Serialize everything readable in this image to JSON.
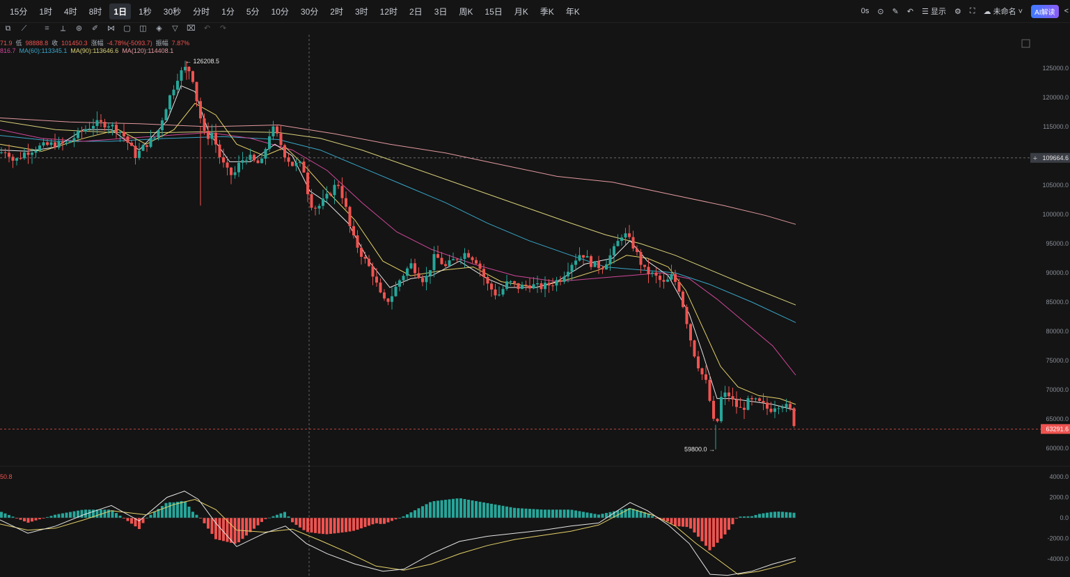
{
  "timeframes": [
    {
      "label": "15分"
    },
    {
      "label": "1时"
    },
    {
      "label": "4时"
    },
    {
      "label": "8时"
    },
    {
      "label": "1日",
      "active": true
    },
    {
      "label": "1秒"
    },
    {
      "label": "30秒"
    },
    {
      "label": "分时"
    },
    {
      "label": "1分"
    },
    {
      "label": "5分"
    },
    {
      "label": "10分"
    },
    {
      "label": "30分"
    },
    {
      "label": "2时"
    },
    {
      "label": "3时"
    },
    {
      "label": "12时"
    },
    {
      "label": "2日"
    },
    {
      "label": "3日"
    },
    {
      "label": "周K"
    },
    {
      "label": "15日"
    },
    {
      "label": "月K"
    },
    {
      "label": "季K"
    },
    {
      "label": "年K"
    }
  ],
  "top_right": {
    "countdown": "0s",
    "display_label": "显示",
    "layout_name": "未命名",
    "ai_label": "AI解读"
  },
  "legend": {
    "ohlc": {
      "open_frag": "71.9",
      "low_label": "低",
      "low": "98888.8",
      "close_label": "收",
      "close": "101450.3",
      "change_label": "涨幅",
      "change": "-4.78%(-5093.7)",
      "amp_label": "振幅",
      "amp": "7.87%"
    },
    "ma": {
      "ma_frag": "816.7",
      "ma60": "MA(60):113345.1",
      "ma90": "MA(90):113646.6",
      "ma120": "MA(120):114408.1"
    },
    "macd_frag": "50.8"
  },
  "colors": {
    "up": "#26a69a",
    "down": "#ef5350",
    "ma5": "#e6e6e6",
    "ma10": "#e7d36a",
    "ma30": "#d2479a",
    "ma60": "#38a6c8",
    "ma90": "#d9d17a",
    "ma120": "#e49aa0",
    "dif": "#e6e6e6",
    "dea": "#e7d36a"
  },
  "chart_data": {
    "type": "candlestick",
    "price_axis": {
      "ticks": [
        125000,
        120000,
        115000,
        110000,
        105000,
        100000,
        95000,
        90000,
        85000,
        80000,
        75000,
        70000,
        65000,
        60000
      ],
      "labels": [
        "125000.0",
        "120000.0",
        "115000.0",
        "110000.0",
        "105000.0",
        "100000.0",
        "95000.0",
        "90000.0",
        "85000.0",
        "80000.0",
        "75000.0",
        "70000.0",
        "65000.0",
        "60000.0"
      ]
    },
    "macd_axis": {
      "ticks": [
        4000,
        2000,
        0,
        -2000,
        -4000
      ],
      "labels": [
        "4000.0",
        "2000.0",
        "0.0",
        "-2000.0",
        "-4000.0"
      ]
    },
    "crosshair_price": "109664.6",
    "last_price": "63291.6",
    "high_annotation": {
      "value": 126208.5,
      "label": "← 126208.5"
    },
    "low_annotation": {
      "value": 59800.0,
      "label": "59800.0 →"
    },
    "price_path": [
      [
        0,
        110500
      ],
      [
        10,
        111000
      ],
      [
        20,
        109000
      ],
      [
        35,
        110500
      ],
      [
        55,
        111500
      ],
      [
        75,
        112000
      ],
      [
        95,
        112000
      ],
      [
        115,
        114000
      ],
      [
        135,
        115500
      ],
      [
        155,
        115500
      ],
      [
        175,
        114000
      ],
      [
        195,
        110000
      ],
      [
        210,
        112000
      ],
      [
        225,
        113500
      ],
      [
        240,
        119000
      ],
      [
        255,
        123500
      ],
      [
        265,
        125000
      ],
      [
        275,
        124500
      ],
      [
        285,
        118000
      ],
      [
        295,
        113000
      ],
      [
        305,
        114000
      ],
      [
        315,
        110000
      ],
      [
        325,
        107500
      ],
      [
        335,
        106500
      ],
      [
        345,
        109000
      ],
      [
        355,
        110000
      ],
      [
        365,
        109000
      ],
      [
        375,
        108500
      ],
      [
        390,
        115000
      ],
      [
        400,
        113000
      ],
      [
        410,
        110000
      ],
      [
        420,
        108500
      ],
      [
        435,
        108500
      ],
      [
        445,
        102000
      ],
      [
        455,
        101000
      ],
      [
        470,
        103000
      ],
      [
        485,
        105500
      ],
      [
        495,
        102000
      ],
      [
        505,
        96500
      ],
      [
        520,
        93000
      ],
      [
        535,
        90000
      ],
      [
        550,
        85000
      ],
      [
        560,
        85500
      ],
      [
        575,
        89000
      ],
      [
        590,
        91500
      ],
      [
        610,
        88500
      ],
      [
        625,
        93000
      ],
      [
        640,
        91000
      ],
      [
        655,
        92500
      ],
      [
        670,
        93500
      ],
      [
        685,
        92000
      ],
      [
        700,
        88000
      ],
      [
        715,
        86000
      ],
      [
        730,
        88500
      ],
      [
        745,
        87500
      ],
      [
        760,
        88000
      ],
      [
        775,
        87500
      ],
      [
        790,
        88000
      ],
      [
        805,
        89000
      ],
      [
        820,
        91500
      ],
      [
        835,
        93500
      ],
      [
        850,
        91500
      ],
      [
        865,
        91000
      ],
      [
        880,
        93500
      ],
      [
        895,
        97000
      ],
      [
        910,
        94500
      ],
      [
        925,
        90500
      ],
      [
        940,
        89500
      ],
      [
        955,
        88000
      ],
      [
        965,
        89500
      ],
      [
        975,
        87500
      ],
      [
        985,
        82500
      ],
      [
        995,
        77000
      ],
      [
        1005,
        73500
      ],
      [
        1015,
        71000
      ],
      [
        1022,
        66500
      ],
      [
        1028,
        62500
      ],
      [
        1035,
        68500
      ],
      [
        1045,
        69500
      ],
      [
        1055,
        67500
      ],
      [
        1065,
        66500
      ],
      [
        1075,
        68000
      ],
      [
        1085,
        68000
      ],
      [
        1095,
        67500
      ],
      [
        1105,
        66500
      ],
      [
        1115,
        67500
      ],
      [
        1125,
        67500
      ],
      [
        1135,
        66500
      ],
      [
        1143,
        63300
      ]
    ],
    "ma_lines": {
      "ma5": [
        [
          0,
          111000
        ],
        [
          40,
          110800
        ],
        [
          80,
          111500
        ],
        [
          120,
          114500
        ],
        [
          160,
          114500
        ],
        [
          200,
          111000
        ],
        [
          240,
          116000
        ],
        [
          260,
          122000
        ],
        [
          280,
          121000
        ],
        [
          300,
          114000
        ],
        [
          330,
          109000
        ],
        [
          360,
          109000
        ],
        [
          395,
          112000
        ],
        [
          420,
          110000
        ],
        [
          445,
          104000
        ],
        [
          470,
          102000
        ],
        [
          500,
          98500
        ],
        [
          530,
          92000
        ],
        [
          560,
          87500
        ],
        [
          590,
          89000
        ],
        [
          620,
          89500
        ],
        [
          660,
          92000
        ],
        [
          700,
          89000
        ],
        [
          730,
          87500
        ],
        [
          770,
          87500
        ],
        [
          800,
          88500
        ],
        [
          840,
          91500
        ],
        [
          880,
          92500
        ],
        [
          905,
          95500
        ],
        [
          930,
          92000
        ],
        [
          960,
          89500
        ],
        [
          990,
          83000
        ],
        [
          1010,
          76000
        ],
        [
          1030,
          68500
        ],
        [
          1050,
          68500
        ],
        [
          1080,
          68000
        ],
        [
          1110,
          67500
        ],
        [
          1143,
          66500
        ]
      ],
      "ma10": [
        [
          0,
          112000
        ],
        [
          60,
          110800
        ],
        [
          120,
          113000
        ],
        [
          170,
          114500
        ],
        [
          210,
          112000
        ],
        [
          250,
          114500
        ],
        [
          280,
          119000
        ],
        [
          310,
          117000
        ],
        [
          340,
          112000
        ],
        [
          380,
          110000
        ],
        [
          410,
          111500
        ],
        [
          440,
          108000
        ],
        [
          470,
          104000
        ],
        [
          510,
          99000
        ],
        [
          550,
          92000
        ],
        [
          590,
          89500
        ],
        [
          640,
          90500
        ],
        [
          680,
          91000
        ],
        [
          720,
          88500
        ],
        [
          770,
          87500
        ],
        [
          820,
          89000
        ],
        [
          860,
          90500
        ],
        [
          900,
          93000
        ],
        [
          930,
          92500
        ],
        [
          960,
          91000
        ],
        [
          985,
          87000
        ],
        [
          1010,
          80500
        ],
        [
          1035,
          74000
        ],
        [
          1060,
          70500
        ],
        [
          1090,
          69000
        ],
        [
          1120,
          68500
        ],
        [
          1143,
          67500
        ]
      ],
      "ma30": [
        [
          0,
          114500
        ],
        [
          60,
          113000
        ],
        [
          120,
          112500
        ],
        [
          180,
          113000
        ],
        [
          240,
          113500
        ],
        [
          300,
          114000
        ],
        [
          360,
          113000
        ],
        [
          420,
          111000
        ],
        [
          470,
          107500
        ],
        [
          520,
          102000
        ],
        [
          570,
          97000
        ],
        [
          620,
          94000
        ],
        [
          680,
          91500
        ],
        [
          740,
          89500
        ],
        [
          800,
          88500
        ],
        [
          850,
          89000
        ],
        [
          900,
          89500
        ],
        [
          950,
          90000
        ],
        [
          990,
          89000
        ],
        [
          1030,
          85500
        ],
        [
          1070,
          81500
        ],
        [
          1110,
          77500
        ],
        [
          1143,
          72500
        ]
      ],
      "ma60": [
        [
          0,
          113500
        ],
        [
          80,
          112500
        ],
        [
          160,
          112500
        ],
        [
          240,
          113000
        ],
        [
          320,
          113300
        ],
        [
          400,
          112800
        ],
        [
          460,
          111000
        ],
        [
          520,
          108000
        ],
        [
          580,
          105000
        ],
        [
          640,
          102000
        ],
        [
          700,
          98500
        ],
        [
          760,
          95500
        ],
        [
          820,
          93000
        ],
        [
          870,
          91000
        ],
        [
          920,
          90500
        ],
        [
          970,
          90000
        ],
        [
          1020,
          88000
        ],
        [
          1080,
          85000
        ],
        [
          1143,
          81500
        ]
      ],
      "ma90": [
        [
          0,
          116000
        ],
        [
          80,
          114500
        ],
        [
          160,
          114000
        ],
        [
          240,
          114000
        ],
        [
          320,
          114200
        ],
        [
          400,
          114000
        ],
        [
          460,
          113000
        ],
        [
          520,
          111000
        ],
        [
          580,
          108500
        ],
        [
          640,
          106000
        ],
        [
          700,
          103500
        ],
        [
          760,
          101000
        ],
        [
          820,
          98500
        ],
        [
          870,
          96500
        ],
        [
          920,
          95000
        ],
        [
          970,
          93000
        ],
        [
          1020,
          90500
        ],
        [
          1080,
          87500
        ],
        [
          1143,
          84500
        ]
      ],
      "ma120": [
        [
          0,
          116500
        ],
        [
          100,
          115800
        ],
        [
          200,
          115500
        ],
        [
          300,
          115000
        ],
        [
          400,
          115300
        ],
        [
          480,
          113800
        ],
        [
          560,
          112000
        ],
        [
          640,
          110500
        ],
        [
          720,
          108500
        ],
        [
          800,
          106500
        ],
        [
          880,
          105500
        ],
        [
          960,
          103500
        ],
        [
          1040,
          101500
        ],
        [
          1100,
          99800
        ],
        [
          1143,
          98300
        ]
      ]
    },
    "macd_lines": {
      "dif": [
        [
          0,
          -200
        ],
        [
          40,
          -1500
        ],
        [
          80,
          -800
        ],
        [
          120,
          300
        ],
        [
          160,
          1200
        ],
        [
          200,
          -300
        ],
        [
          240,
          2000
        ],
        [
          265,
          2600
        ],
        [
          285,
          1800
        ],
        [
          310,
          -500
        ],
        [
          340,
          -2800
        ],
        [
          380,
          -1500
        ],
        [
          410,
          -800
        ],
        [
          440,
          -2500
        ],
        [
          470,
          -3500
        ],
        [
          510,
          -4500
        ],
        [
          550,
          -5200
        ],
        [
          580,
          -5000
        ],
        [
          620,
          -3500
        ],
        [
          660,
          -2300
        ],
        [
          700,
          -1800
        ],
        [
          740,
          -1500
        ],
        [
          780,
          -1200
        ],
        [
          820,
          -800
        ],
        [
          860,
          -500
        ],
        [
          905,
          1500
        ],
        [
          930,
          700
        ],
        [
          960,
          -700
        ],
        [
          990,
          -2500
        ],
        [
          1020,
          -5500
        ],
        [
          1045,
          -5600
        ],
        [
          1080,
          -5200
        ],
        [
          1110,
          -4500
        ],
        [
          1143,
          -3900
        ]
      ],
      "dea": [
        [
          0,
          -600
        ],
        [
          40,
          -1200
        ],
        [
          80,
          -1000
        ],
        [
          120,
          -200
        ],
        [
          160,
          700
        ],
        [
          210,
          300
        ],
        [
          250,
          1300
        ],
        [
          280,
          1800
        ],
        [
          310,
          800
        ],
        [
          340,
          -1200
        ],
        [
          380,
          -1400
        ],
        [
          420,
          -1100
        ],
        [
          460,
          -2200
        ],
        [
          500,
          -3400
        ],
        [
          540,
          -4700
        ],
        [
          580,
          -5100
        ],
        [
          620,
          -4500
        ],
        [
          660,
          -3500
        ],
        [
          700,
          -2700
        ],
        [
          740,
          -2100
        ],
        [
          780,
          -1700
        ],
        [
          820,
          -1300
        ],
        [
          860,
          -700
        ],
        [
          905,
          900
        ],
        [
          940,
          200
        ],
        [
          970,
          -800
        ],
        [
          1000,
          -2500
        ],
        [
          1030,
          -4000
        ],
        [
          1060,
          -5500
        ],
        [
          1090,
          -5200
        ],
        [
          1120,
          -4700
        ],
        [
          1143,
          -4200
        ]
      ]
    }
  }
}
